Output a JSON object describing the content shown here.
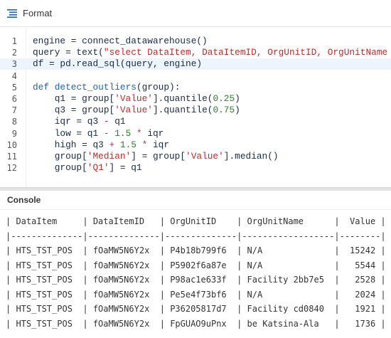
{
  "toolbar": {
    "format_label": "Format",
    "format_icon": "format-lines-icon",
    "accent_color": "#1565c0"
  },
  "editor": {
    "active_line": 3,
    "lines": [
      {
        "n": "1",
        "tokens": [
          [
            "t",
            "engine = connect_datawarehouse()"
          ]
        ]
      },
      {
        "n": "2",
        "tokens": [
          [
            "t",
            "query = text("
          ],
          [
            "str",
            "\"select DataItem, DataItemID, OrgUnitID, OrgUnitName"
          ]
        ]
      },
      {
        "n": "3",
        "tokens": [
          [
            "t",
            "df = pd.read_sql(query, engine)"
          ]
        ]
      },
      {
        "n": "4",
        "tokens": []
      },
      {
        "n": "5",
        "tokens": [
          [
            "kw",
            "def"
          ],
          [
            "t",
            " "
          ],
          [
            "fn",
            "detect_outliers"
          ],
          [
            "t",
            "(group):"
          ]
        ]
      },
      {
        "n": "6",
        "tokens": [
          [
            "t",
            "    q1 = group["
          ],
          [
            "str",
            "'Value'"
          ],
          [
            "t",
            "].quantile("
          ],
          [
            "num",
            "0.25"
          ],
          [
            "t",
            ")"
          ]
        ]
      },
      {
        "n": "7",
        "tokens": [
          [
            "t",
            "    q3 = group["
          ],
          [
            "str",
            "'Value'"
          ],
          [
            "t",
            "].quantile("
          ],
          [
            "num",
            "0.75"
          ],
          [
            "t",
            ")"
          ]
        ]
      },
      {
        "n": "8",
        "tokens": [
          [
            "t",
            "    iqr = q3 "
          ],
          [
            "op",
            "-"
          ],
          [
            "t",
            " q1"
          ]
        ]
      },
      {
        "n": "9",
        "tokens": [
          [
            "t",
            "    low = q1 "
          ],
          [
            "op",
            "-"
          ],
          [
            "t",
            " "
          ],
          [
            "num",
            "1.5"
          ],
          [
            "t",
            " "
          ],
          [
            "op",
            "*"
          ],
          [
            "t",
            " iqr"
          ]
        ]
      },
      {
        "n": "10",
        "tokens": [
          [
            "t",
            "    high = q3 "
          ],
          [
            "op",
            "+"
          ],
          [
            "t",
            " "
          ],
          [
            "num",
            "1.5"
          ],
          [
            "t",
            " "
          ],
          [
            "op",
            "*"
          ],
          [
            "t",
            " iqr"
          ]
        ]
      },
      {
        "n": "11",
        "tokens": [
          [
            "t",
            "    group["
          ],
          [
            "str",
            "'Median'"
          ],
          [
            "t",
            "] = group["
          ],
          [
            "str",
            "'Value'"
          ],
          [
            "t",
            "].median()"
          ]
        ]
      },
      {
        "n": "12",
        "tokens": [
          [
            "t",
            "    group["
          ],
          [
            "str",
            "'Q1'"
          ],
          [
            "t",
            "] = q1"
          ]
        ]
      }
    ]
  },
  "console": {
    "title": "Console",
    "output_lines": [
      "| DataItem     | DataItemID   | OrgUnitID    | OrgUnitName      |  Value |",
      "|--------------|--------------|--------------|------------------|--------|",
      "| HTS_TST_POS  | fOaMW5N6Y2x  | P4b18b799f6  | N/A              |  15242 |",
      "| HTS_TST_POS  | fOaMW5N6Y2x  | P5902f6a87e  | N/A              |   5544 |",
      "| HTS_TST_POS  | fOaMW5N6Y2x  | P98ac1e633f  | Facility 2bb7e5  |   2528 |",
      "| HTS_TST_POS  | fOaMW5N6Y2x  | Pe5e4f73bf6  | N/A              |   2024 |",
      "| HTS_TST_POS  | fOaMW5N6Y2x  | P36205817d7  | Facility cd0840  |   1921 |",
      "| HTS_TST_POS  | fOaMW5N6Y2x  | FpGUAO9uPnx  | be Katsina-Ala   |   1736 |"
    ]
  }
}
